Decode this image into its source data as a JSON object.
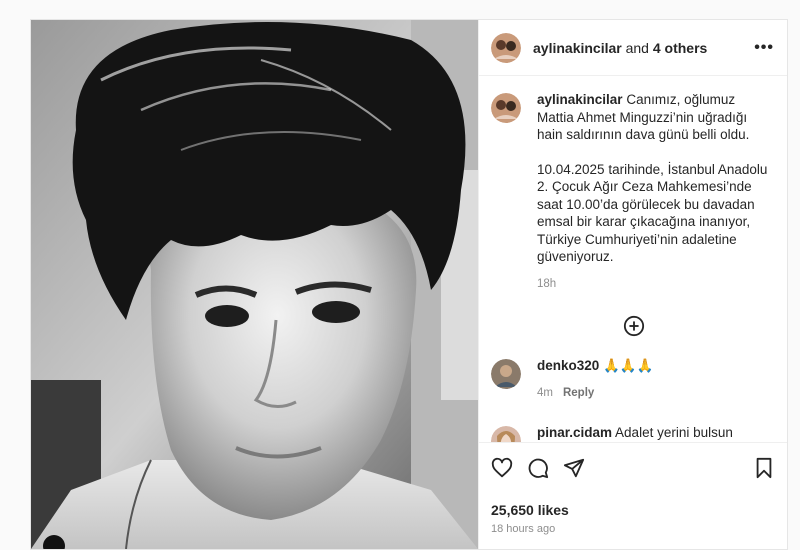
{
  "header": {
    "username": "aylinakincilar",
    "connector": " and ",
    "others": "4 others",
    "more_icon": "more-icon"
  },
  "caption": {
    "username": "aylinakincilar",
    "text": "Canımız, oğlumuz Mattia Ahmet Minguzzi’nin uğradığı hain saldırının dava günü belli oldu.",
    "text2": "10.04.2025 tarihinde, İstanbul Anadolu 2. Çocuk Ağır Ceza Mahkemesi’nde saat 10.00’da görülecek bu davadan emsal bir karar çıkacağına inanıyor, Türkiye Cumhuriyeti’nin adaletine güveniyoruz.",
    "time": "18h"
  },
  "comments": [
    {
      "username": "denko320",
      "text": "🙏🙏🙏",
      "time": "4m",
      "reply": "Reply"
    },
    {
      "username": "pinar.cidam",
      "text": "Adalet yerini bulsun"
    }
  ],
  "actions": {
    "icons": [
      "heart-icon",
      "comment-icon",
      "share-icon",
      "bookmark-icon"
    ],
    "likes": "25,650 likes",
    "time_ago": "18 hours ago"
  },
  "colors": {
    "text": "#262626",
    "muted": "#8e8e8e",
    "border": "#efefef"
  }
}
